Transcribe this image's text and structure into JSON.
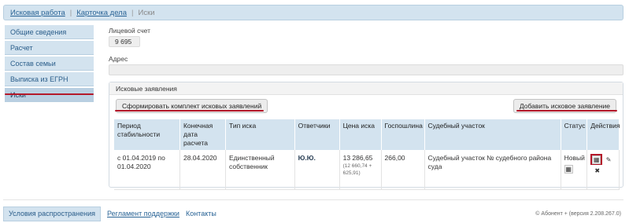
{
  "breadcrumb": {
    "items": [
      "Исковая работа",
      "Карточка дела"
    ],
    "current": "Иски"
  },
  "sidebar": {
    "items": [
      {
        "label": "Общие сведения"
      },
      {
        "label": "Расчет"
      },
      {
        "label": "Состав семьи"
      },
      {
        "label": "Выписка из ЕГРН"
      },
      {
        "label": "Иски"
      }
    ],
    "active_index": 4
  },
  "account": {
    "label": "Лицевой счет",
    "value": "9    695"
  },
  "address": {
    "label": "Адрес",
    "value": ""
  },
  "claims": {
    "panel_title": "Исковые заявления",
    "generate_button": "Сформировать комплект исковых заявлений",
    "add_button": "Добавить исковое заявление",
    "columns": [
      "Период стабильности",
      "Конечная дата расчета",
      "Тип иска",
      "Ответчики",
      "Цена иска",
      "Госпошлина",
      "Судебный участок",
      "Статус",
      "Действия"
    ],
    "rows": [
      {
        "period": "с 01.04.2019 по 01.04.2020",
        "end_date": "28.04.2020",
        "type": "Единственный собственник",
        "defendants": "Ю.Ю.",
        "price": "13 286,65",
        "price_detail": "(12 660,74 + 625,91)",
        "fee": "266,00",
        "court": "Судебный участок №     судебного района суда",
        "status": "Новый"
      }
    ]
  },
  "footer": {
    "terms": "Условия распространения",
    "support": "Регламент поддержки",
    "contacts": "Контакты",
    "copyright": "© Абонент + (версия 2.208.267.0)"
  },
  "colors": {
    "accent": "#d3e3ef",
    "highlight": "#b4182a"
  }
}
